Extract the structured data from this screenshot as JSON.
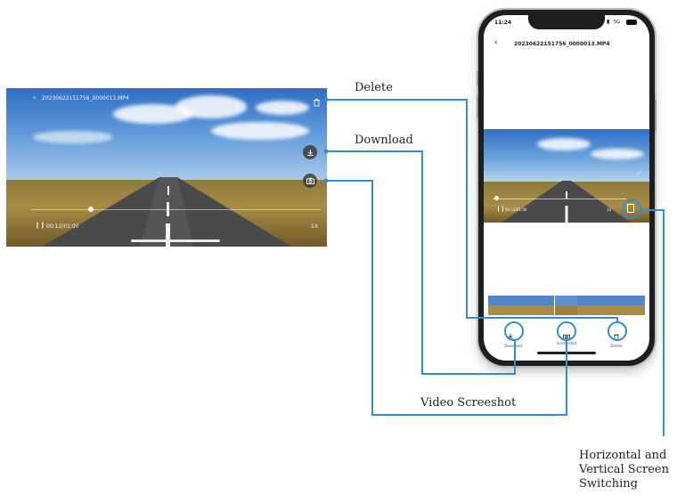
{
  "landscape_player": {
    "file_name": "20230622151756_0000013.MP4",
    "current_time": "00:12/01:00",
    "speed": "1X",
    "icons": {
      "back": "chevron-left-icon",
      "delete": "trash-icon",
      "download": "download-icon",
      "screenshot": "camera-icon",
      "pause": "pause-icon"
    }
  },
  "phone": {
    "status_time": "11:24",
    "network": "5G",
    "file_name": "20230622151756_0000013.MP4",
    "current_time": "00:12/01:00",
    "speed": "1X",
    "actions": [
      {
        "icon": "download-icon",
        "label": "Download"
      },
      {
        "icon": "camera-icon",
        "label": "Video Screenshot"
      },
      {
        "icon": "trash-icon",
        "label": "Delete"
      }
    ]
  },
  "callouts": {
    "delete": "Delete",
    "download": "Download",
    "video_screenshot": "Video Screeshot",
    "orientation_line1": "Horizontal and",
    "orientation_line2": "Vertical Screen",
    "orientation_line3": "Switching"
  },
  "colors": {
    "callout_line": "#2f8fd0",
    "sky": "#2f6fc4",
    "ground": "#a88c45"
  }
}
